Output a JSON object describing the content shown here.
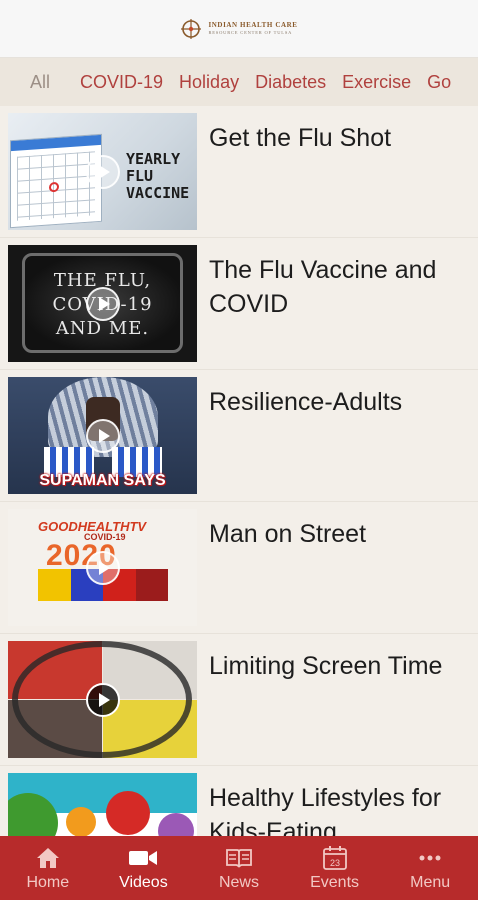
{
  "header": {
    "logo_title": "INDIAN HEALTH CARE",
    "logo_subtitle": "RESOURCE CENTER OF TULSA"
  },
  "tabs": [
    {
      "label": "All"
    },
    {
      "label": "COVID-19"
    },
    {
      "label": "Holiday"
    },
    {
      "label": "Diabetes"
    },
    {
      "label": "Exercise"
    },
    {
      "label": "Go"
    }
  ],
  "videos": [
    {
      "title": "Get the Flu Shot",
      "thumb_text": "YEARLY FLU VACCINE"
    },
    {
      "title": "The Flu Vaccine and COVID",
      "thumb_text": "THE FLU, COVID-19 AND ME."
    },
    {
      "title": "Resilience-Adults",
      "thumb_text": "SUPAMAN SAYS"
    },
    {
      "title": "Man on Street",
      "thumb_text": "GOODHEALTHTV",
      "thumb_sub": "COVID-19",
      "thumb_year": "2020"
    },
    {
      "title": "Limiting Screen Time"
    },
    {
      "title": "Healthy Lifestyles for Kids-Eating"
    }
  ],
  "nav": [
    {
      "label": "Home",
      "icon": "home-icon"
    },
    {
      "label": "Videos",
      "icon": "video-camera-icon"
    },
    {
      "label": "News",
      "icon": "newspaper-icon"
    },
    {
      "label": "Events",
      "icon": "calendar-icon",
      "badge": "23"
    },
    {
      "label": "Menu",
      "icon": "more-dots-icon"
    }
  ],
  "colors": {
    "accent": "#b72b2b",
    "tab_text": "#b0413e",
    "background": "#f3efe9"
  }
}
